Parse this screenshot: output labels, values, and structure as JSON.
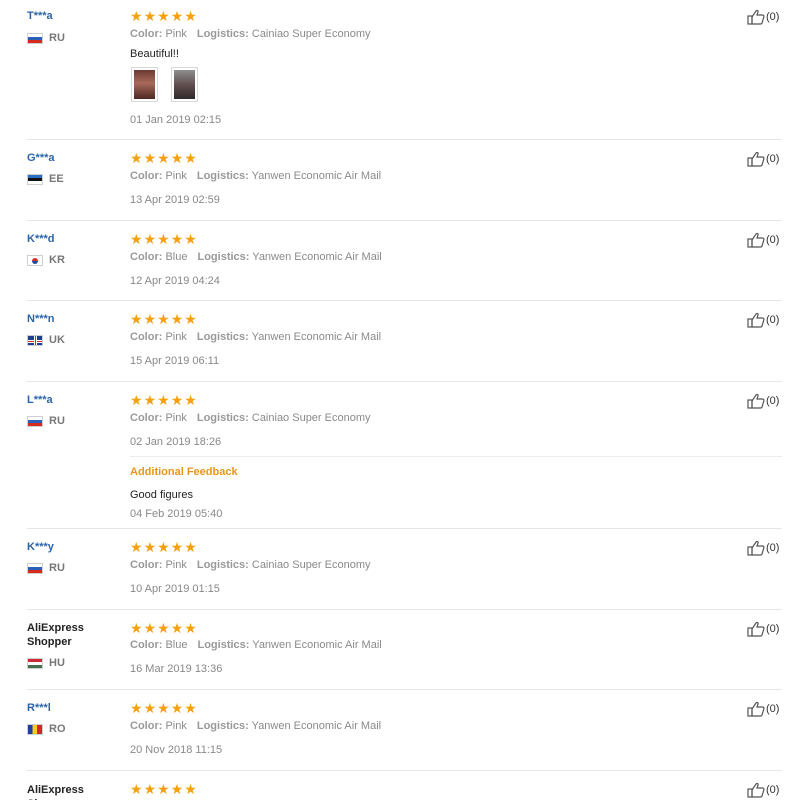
{
  "labels": {
    "color": "Color:",
    "logistics": "Logistics:",
    "additional_feedback": "Additional Feedback"
  },
  "colors": {
    "star": "#f6a00f",
    "username_link": "#2a64a8",
    "additional_feedback": "#e8961a"
  },
  "reviews": [
    {
      "user": "T***a",
      "user_is_link": true,
      "country": "RU",
      "flag": "ru",
      "rating": 5,
      "color": "Pink",
      "logistics": "Cainiao Super Economy",
      "text": "Beautiful!!",
      "photos": 2,
      "date": "01 Jan 2019 02:15",
      "likes": "(0)"
    },
    {
      "user": "G***a",
      "user_is_link": true,
      "country": "EE",
      "flag": "ee",
      "rating": 5,
      "color": "Pink",
      "logistics": "Yanwen Economic Air Mail",
      "date": "13 Apr 2019 02:59",
      "likes": "(0)"
    },
    {
      "user": "K***d",
      "user_is_link": true,
      "country": "KR",
      "flag": "kr",
      "rating": 5,
      "color": "Blue",
      "logistics": "Yanwen Economic Air Mail",
      "date": "12 Apr 2019 04:24",
      "likes": "(0)"
    },
    {
      "user": "N***n",
      "user_is_link": true,
      "country": "UK",
      "flag": "uk",
      "rating": 5,
      "color": "Pink",
      "logistics": "Yanwen Economic Air Mail",
      "date": "15 Apr 2019 06:11",
      "likes": "(0)"
    },
    {
      "user": "L***a",
      "user_is_link": true,
      "country": "RU",
      "flag": "ru",
      "rating": 5,
      "color": "Pink",
      "logistics": "Cainiao Super Economy",
      "date": "02 Jan 2019 18:26",
      "likes": "(0)",
      "additional_text": "Good figures",
      "additional_date": "04 Feb 2019 05:40"
    },
    {
      "user": "K***y",
      "user_is_link": true,
      "country": "RU",
      "flag": "ru",
      "rating": 5,
      "color": "Pink",
      "logistics": "Cainiao Super Economy",
      "date": "10 Apr 2019 01:15",
      "likes": "(0)"
    },
    {
      "user": "AliExpress Shopper",
      "user_is_link": false,
      "country": "HU",
      "flag": "hu",
      "rating": 5,
      "color": "Blue",
      "logistics": "Yanwen Economic Air Mail",
      "date": "16 Mar 2019 13:36",
      "likes": "(0)"
    },
    {
      "user": "R***l",
      "user_is_link": true,
      "country": "RO",
      "flag": "ro",
      "rating": 5,
      "color": "Pink",
      "logistics": "Yanwen Economic Air Mail",
      "date": "20 Nov 2018 11:15",
      "likes": "(0)"
    },
    {
      "user": "AliExpress Shopper",
      "user_is_link": false,
      "rating": 5,
      "likes": "(0)"
    }
  ]
}
